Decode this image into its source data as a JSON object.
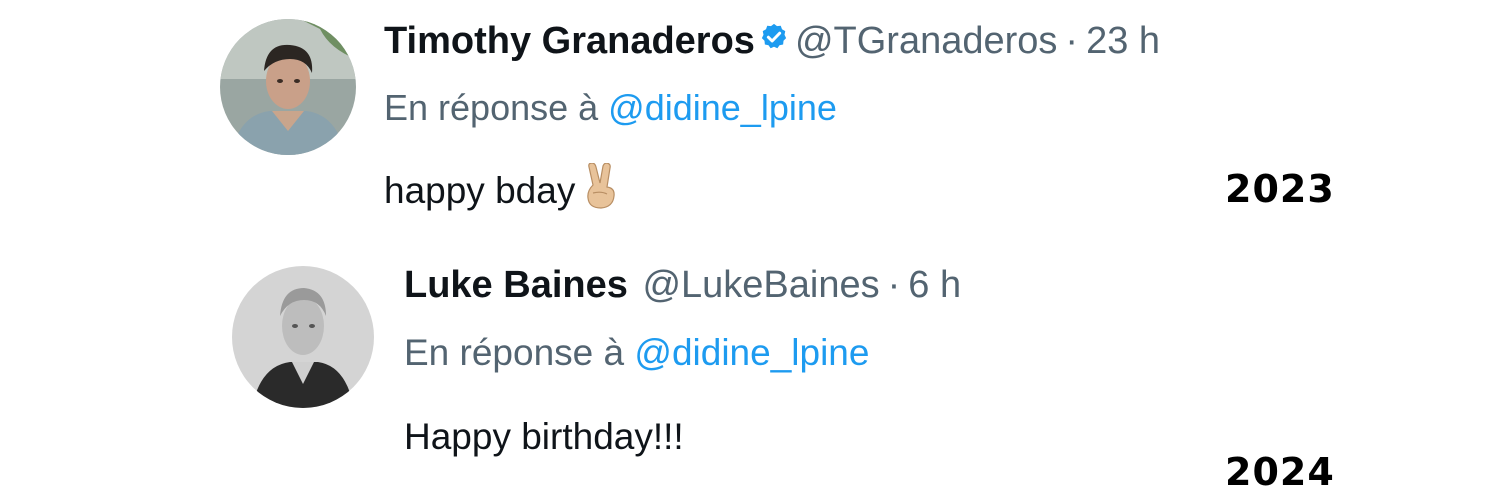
{
  "tweets": [
    {
      "author_name": "Timothy Granaderos",
      "verified": true,
      "handle": "@TGranaderos",
      "separator": "·",
      "time": "23 h",
      "reply_prefix": "En réponse à",
      "reply_to": "@didine_lpine",
      "text": "happy bday",
      "emoji": "victory-hand-icon",
      "year_label": "2023"
    },
    {
      "author_name": "Luke Baines",
      "verified": false,
      "handle": "@LukeBaines",
      "separator": "·",
      "time": "6 h",
      "reply_prefix": "En réponse à",
      "reply_to": "@didine_lpine",
      "text": "Happy birthday!!!",
      "year_label": "2024"
    }
  ],
  "colors": {
    "name": "#0f1419",
    "muted": "#536471",
    "mention": "#1d9bf0",
    "verified_badge": "#1d9bf0"
  }
}
